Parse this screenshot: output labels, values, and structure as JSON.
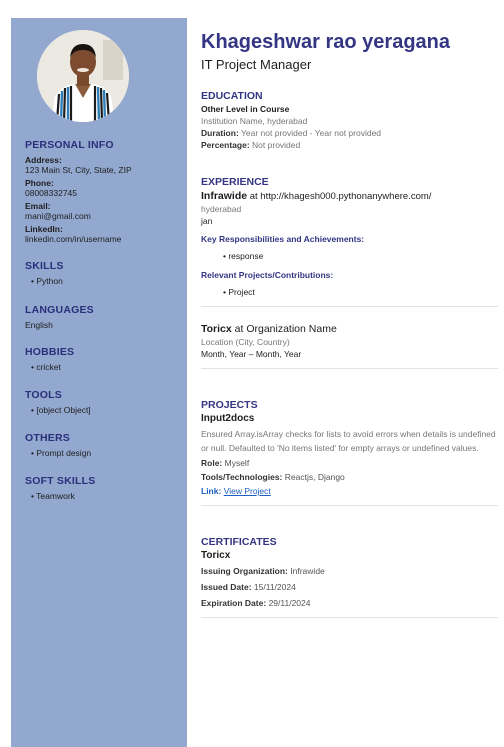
{
  "profile": {
    "name": "Khageshwar rao yeragana",
    "title": "IT Project Manager"
  },
  "sidebar": {
    "personal_info": {
      "heading": "PERSONAL INFO",
      "address_label": "Address:",
      "address": "123 Main St, City, State, ZIP",
      "phone_label": "Phone:",
      "phone": "08008332745",
      "email_label": "Email:",
      "email": "mani@gmail.com",
      "linkedin_label": "LinkedIn:",
      "linkedin": "linkedin.com/in/username"
    },
    "skills": {
      "heading": "SKILLS",
      "items": [
        "• Python"
      ]
    },
    "languages": {
      "heading": "LANGUAGES",
      "value": "English"
    },
    "hobbies": {
      "heading": "HOBBIES",
      "items": [
        "• cricket"
      ]
    },
    "tools": {
      "heading": "TOOLS",
      "items": [
        "• [object Object]"
      ]
    },
    "others": {
      "heading": "OTHERS",
      "items": [
        "• Prompt design"
      ]
    },
    "soft_skills": {
      "heading": "SOFT SKILLS",
      "items": [
        "• Teamwork"
      ]
    }
  },
  "education": {
    "heading": "EDUCATION",
    "level": "Other Level in Course",
    "institution": "Institution Name, hyderabad",
    "duration_label": "Duration:",
    "duration": "Year not provided - Year not provided",
    "percentage_label": "Percentage:",
    "percentage": "Not provided"
  },
  "experience": {
    "heading": "EXPERIENCE",
    "jobs": [
      {
        "company": "Infrawide",
        "at": " at ",
        "org": "http://khagesh000.pythonanywhere.com/",
        "location": "hyderabad",
        "dates": "jan",
        "resp_heading": "Key Responsibilities and Achievements:",
        "resp": "• response",
        "proj_heading": "Relevant Projects/Contributions:",
        "proj": "• Project"
      },
      {
        "company": "Toricx",
        "at": " at ",
        "org": "Organization Name",
        "location": "Location (City, Country)",
        "dates": "Month, Year – Month, Year"
      }
    ]
  },
  "projects": {
    "heading": "PROJECTS",
    "items": [
      {
        "name": "Input2docs",
        "description": "Ensured Array.isArray checks for lists to avoid errors when details is undefined or null. Defaulted to 'No items listed' for empty arrays or undefined values.",
        "role_label": "Role:",
        "role": "Myself",
        "tools_label": "Tools/Technologies:",
        "tools": "Reactjs, Django",
        "link_label": "Link:",
        "link_text": "View Project"
      }
    ]
  },
  "certificates": {
    "heading": "CERTIFICATES",
    "items": [
      {
        "name": "Toricx",
        "issuer_label": "Issuing Organization:",
        "issuer": "Infrawide",
        "issued_label": "Issued Date:",
        "issued": "15/11/2024",
        "expiry_label": "Expiration Date:",
        "expiry": "29/11/2024"
      }
    ]
  },
  "colors": {
    "sidebar_bg": "#93a8cf",
    "accent": "#343583",
    "link": "#1a5fc2"
  }
}
